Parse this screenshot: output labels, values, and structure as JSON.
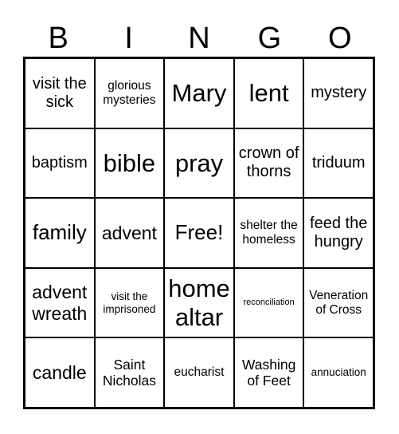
{
  "header": [
    "B",
    "I",
    "N",
    "G",
    "O"
  ],
  "cells": [
    [
      "visit the sick",
      "glorious mysteries",
      "Mary",
      "lent",
      "mystery"
    ],
    [
      "baptism",
      "bible",
      "pray",
      "crown of thorns",
      "triduum"
    ],
    [
      "family",
      "advent",
      "Free!",
      "shelter the homeless",
      "feed the hungry"
    ],
    [
      "advent wreath",
      "visit the imprisoned",
      "home altar",
      "reconciliation",
      "Veneration of Cross"
    ],
    [
      "candle",
      "Saint Nicholas",
      "eucharist",
      "Washing of Feet",
      "annuciation"
    ]
  ]
}
